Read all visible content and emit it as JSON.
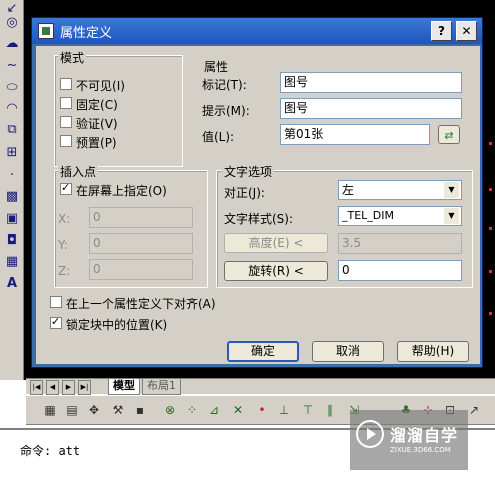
{
  "dialog": {
    "title": "属性定义",
    "help_btn": "?",
    "close_btn": "✕",
    "mode": {
      "title": "模式",
      "options": [
        {
          "label": "不可见",
          "key": "(I)",
          "checked": false
        },
        {
          "label": "固定",
          "key": "(C)",
          "checked": false
        },
        {
          "label": "验证",
          "key": "(V)",
          "checked": false
        },
        {
          "label": "预置",
          "key": "(P)",
          "checked": false
        }
      ]
    },
    "attribute": {
      "title": "属性",
      "tag_label": "标记(T):",
      "tag_value": "图号",
      "prompt_label": "提示(M):",
      "prompt_value": "图号",
      "value_label": "值(L):",
      "value_value": "第01张"
    },
    "insertion": {
      "title": "插入点",
      "on_screen_label": "在屏幕上指定(O)",
      "on_screen_checked": true,
      "x_label": "X:",
      "x_value": "0",
      "y_label": "Y:",
      "y_value": "0",
      "z_label": "Z:",
      "z_value": "0"
    },
    "text_options": {
      "title": "文字选项",
      "justify_label": "对正(J):",
      "justify_value": "左",
      "style_label": "文字样式(S):",
      "style_value": "_TEL_DIM",
      "height_btn": "高度(E) <",
      "height_value": "3.5",
      "rotation_btn": "旋转(R) <",
      "rotation_value": "0"
    },
    "align_below_label": "在上一个属性定义下对齐(A)",
    "align_below_checked": false,
    "lock_position_label": "锁定块中的位置(K)",
    "lock_position_checked": true,
    "ok_btn": "确定",
    "cancel_btn": "取消",
    "help_btn2": "帮助(H)"
  },
  "tabs": {
    "model": "模型",
    "layout1": "布局1"
  },
  "command_line": "命令: att",
  "watermark": {
    "brand": "溜溜自学",
    "url": "ZIXUE.3D66.COM"
  },
  "colors": {
    "titlebar": "#1e55c0",
    "dialog_bg": "#d4d0c8",
    "canvas": "#000000"
  }
}
